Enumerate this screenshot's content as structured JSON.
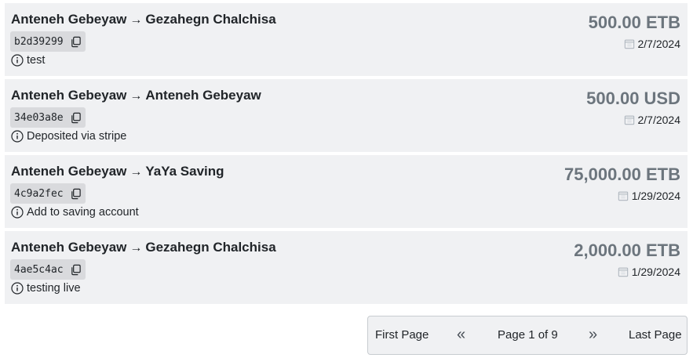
{
  "transactions": [
    {
      "sender": "Anteneh Gebeyaw",
      "receiver": "Gezahegn Chalchisa",
      "arrow": "→",
      "hash": "b2d39299",
      "note": "test",
      "amount": "500.00 ETB",
      "date": "2/7/2024"
    },
    {
      "sender": "Anteneh Gebeyaw",
      "receiver": "Anteneh Gebeyaw",
      "arrow": "→",
      "hash": "34e03a8e",
      "note": "Deposited via stripe",
      "amount": "500.00 USD",
      "date": "2/7/2024"
    },
    {
      "sender": "Anteneh Gebeyaw",
      "receiver": "YaYa Saving",
      "arrow": "→",
      "hash": "4c9a2fec",
      "note": "Add to saving account",
      "amount": "75,000.00 ETB",
      "date": "1/29/2024"
    },
    {
      "sender": "Anteneh Gebeyaw",
      "receiver": "Gezahegn Chalchisa",
      "arrow": "→",
      "hash": "4ae5c4ac",
      "note": "testing live",
      "amount": "2,000.00 ETB",
      "date": "1/29/2024"
    }
  ],
  "pagination": {
    "first_label": "First Page",
    "prev_label": "«",
    "status": "Page 1 of 9",
    "next_label": "»",
    "last_label": "Last Page"
  },
  "icons": {
    "copy": "copy-icon",
    "info": "info-icon",
    "calendar": "calendar-icon"
  },
  "colors": {
    "card_bg": "#f0f1f3",
    "chip_bg": "#d9dadd",
    "amount": "#6c757d",
    "text": "#212529"
  }
}
